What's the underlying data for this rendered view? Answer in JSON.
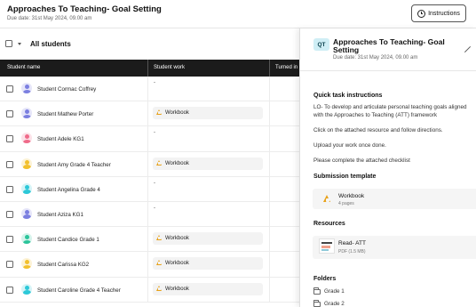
{
  "header": {
    "title": "Approaches To Teaching- Goal Setting",
    "due": "Due date: 31st May 2024, 09.00 am",
    "instructions_button": "Instructions"
  },
  "left_pane": {
    "select_label": "All students",
    "columns": [
      "Student name",
      "Student work",
      "Turned in"
    ],
    "students": [
      {
        "name": "Student Cormac Coffrey",
        "work": "-",
        "avatar_color": "#7b7fe0"
      },
      {
        "name": "Student Mathew Porter",
        "work": "Workbook",
        "avatar_color": "#7b7fe0"
      },
      {
        "name": "Student Adele KG1",
        "work": "-",
        "avatar_color": "#ef6b8a"
      },
      {
        "name": "Student Amy Grade 4 Teacher",
        "work": "Workbook",
        "avatar_color": "#f2c02c"
      },
      {
        "name": "Student Angelina Grade 4",
        "work": "-",
        "avatar_color": "#2cc8d8"
      },
      {
        "name": "Student Aziza KG1",
        "work": "-",
        "avatar_color": "#7b7fe0"
      },
      {
        "name": "Student Candice Grade 1",
        "work": "Workbook",
        "avatar_color": "#2bc49a"
      },
      {
        "name": "Student Carissa KG2",
        "work": "Workbook",
        "avatar_color": "#f2c02c"
      },
      {
        "name": "Student Caroline Grade 4 Teacher",
        "work": "Workbook",
        "avatar_color": "#2cc8d8"
      }
    ]
  },
  "panel": {
    "badge": "QT",
    "title": "Approaches To Teaching- Goal Setting",
    "due": "Due date: 31st May 2024, 09.00 am",
    "quick_title": "Quick task instructions",
    "instructions": [
      "LO- To develop and articulate personal teaching goals aligned",
      "with the Approaches to Teaching (ATT) framework",
      "Click on the attached resource and follow directions.",
      "Upload your work once done.",
      "Please complete the attached checklist"
    ],
    "submission_title": "Submission template",
    "submission_card": {
      "title": "Workbook",
      "sub": "4 pages"
    },
    "resources_title": "Resources",
    "resource_card": {
      "title": "Read- ATT",
      "sub": "PDF (1.5 MB)"
    },
    "folders_title": "Folders",
    "folders": [
      "Grade 1",
      "Grade 2"
    ]
  },
  "colors": {
    "header_bg": "#1b1b1b",
    "badge_bg": "#cfeef5",
    "workbook_icon": "#e8a21a"
  }
}
